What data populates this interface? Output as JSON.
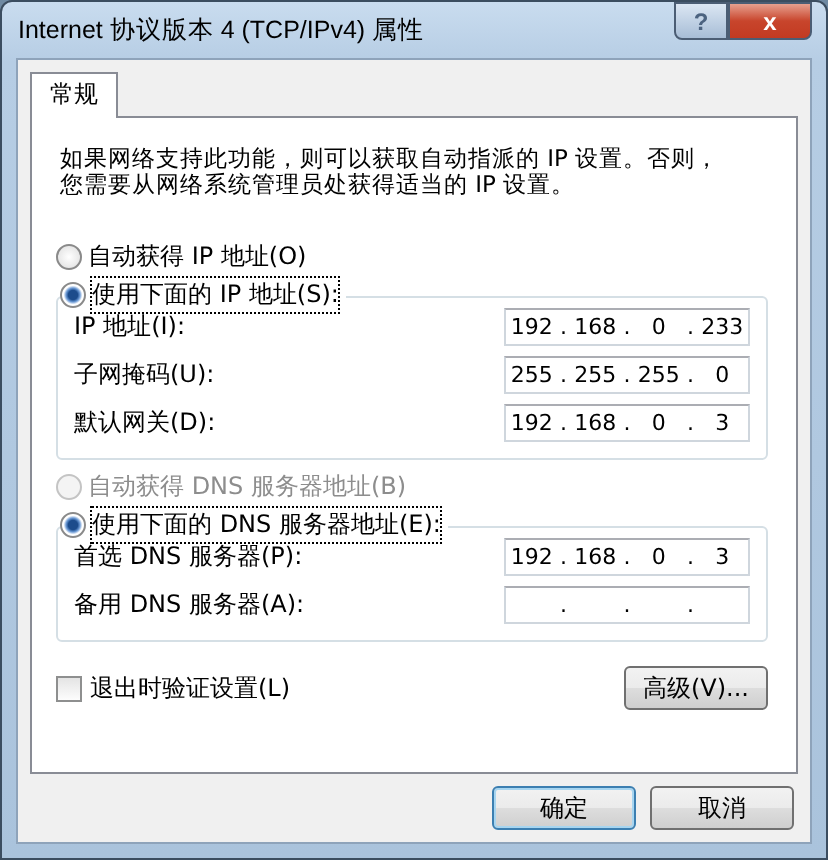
{
  "window": {
    "title": "Internet 协议版本 4 (TCP/IPv4) 属性",
    "help_button": "?",
    "close_button": "x"
  },
  "tabs": [
    {
      "label": "常规",
      "selected": true
    }
  ],
  "description": "如果网络支持此功能，则可以获取自动指派的 IP 设置。否则，您需要从网络系统管理员处获得适当的 IP 设置。",
  "octet_separator": ".",
  "ip_section": {
    "options": [
      {
        "label": "自动获得 IP 地址(O)",
        "selected": false,
        "disabled": false
      },
      {
        "label": "使用下面的 IP 地址(S):",
        "selected": true,
        "disabled": false
      }
    ],
    "fields": [
      {
        "label": "IP 地址(I):",
        "octets": [
          "192",
          "168",
          "0",
          "233"
        ]
      },
      {
        "label": "子网掩码(U):",
        "octets": [
          "255",
          "255",
          "255",
          "0"
        ]
      },
      {
        "label": "默认网关(D):",
        "octets": [
          "192",
          "168",
          "0",
          "3"
        ]
      }
    ]
  },
  "dns_section": {
    "options": [
      {
        "label": "自动获得 DNS 服务器地址(B)",
        "selected": false,
        "disabled": true
      },
      {
        "label": "使用下面的 DNS 服务器地址(E):",
        "selected": true,
        "disabled": false
      }
    ],
    "fields": [
      {
        "label": "首选 DNS 服务器(P):",
        "octets": [
          "192",
          "168",
          "0",
          "3"
        ]
      },
      {
        "label": "备用 DNS 服务器(A):"
      }
    ]
  },
  "validate_checkbox": {
    "label": "退出时验证设置(L)",
    "checked": false
  },
  "advanced_button": "高级(V)...",
  "buttons": [
    {
      "label": "确定",
      "default": true
    },
    {
      "label": "取消",
      "default": false
    }
  ]
}
